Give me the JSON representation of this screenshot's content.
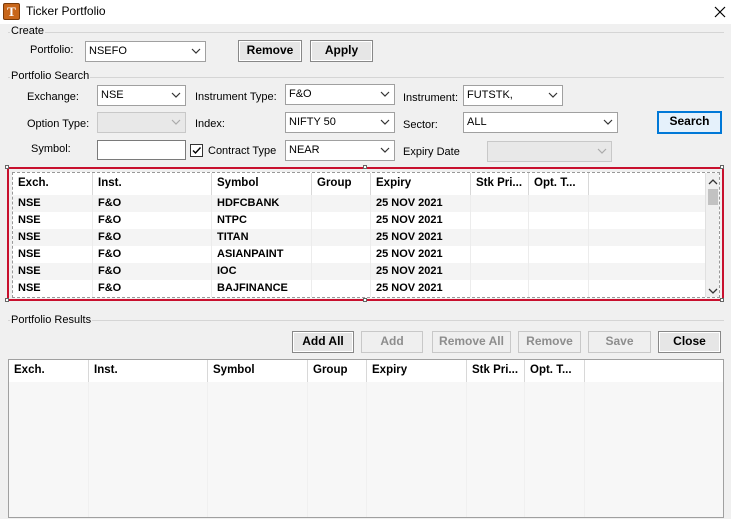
{
  "window": {
    "title": "Ticker Portfolio",
    "icon_letter": "T"
  },
  "create": {
    "legend": "Create",
    "portfolio_label": "Portfolio:",
    "portfolio_value": "NSEFO",
    "remove_label": "Remove",
    "apply_label": "Apply"
  },
  "search": {
    "legend": "Portfolio Search",
    "exchange_label": "Exchange:",
    "exchange_value": "NSE",
    "instrument_type_label": "Instrument Type:",
    "instrument_type_value": "F&O",
    "instrument_label": "Instrument:",
    "instrument_value": "FUTSTK,",
    "option_type_label": "Option Type:",
    "option_type_value": "",
    "index_label": "Index:",
    "index_value": "NIFTY 50",
    "sector_label": "Sector:",
    "sector_value": "ALL",
    "search_label": "Search",
    "symbol_label": "Symbol:",
    "symbol_value": "",
    "contract_type_label": "Contract Type",
    "contract_type_value": "NEAR",
    "expiry_label": "Expiry Date",
    "expiry_value": ""
  },
  "columns": [
    "Exch.",
    "Inst.",
    "Symbol",
    "Group",
    "Expiry",
    "Stk Pri...",
    "Opt. T..."
  ],
  "search_rows": [
    [
      "NSE",
      "F&O",
      "HDFCBANK",
      "",
      "25 NOV 2021",
      "",
      ""
    ],
    [
      "NSE",
      "F&O",
      "NTPC",
      "",
      "25 NOV 2021",
      "",
      ""
    ],
    [
      "NSE",
      "F&O",
      "TITAN",
      "",
      "25 NOV 2021",
      "",
      ""
    ],
    [
      "NSE",
      "F&O",
      "ASIANPAINT",
      "",
      "25 NOV 2021",
      "",
      ""
    ],
    [
      "NSE",
      "F&O",
      "IOC",
      "",
      "25 NOV 2021",
      "",
      ""
    ],
    [
      "NSE",
      "F&O",
      "BAJFINANCE",
      "",
      "25 NOV 2021",
      "",
      ""
    ]
  ],
  "results": {
    "legend": "Portfolio Results",
    "add_all_label": "Add All",
    "add_label": "Add",
    "remove_all_label": "Remove All",
    "remove_label": "Remove",
    "save_label": "Save",
    "close_label": "Close"
  },
  "icons": {
    "close": "close-icon",
    "dropdown": "chevron-down-icon",
    "check": "checkmark-icon",
    "scroll_up": "chevron-up-icon",
    "scroll_down": "chevron-down-icon"
  },
  "colors": {
    "selection_frame": "#c8102e",
    "default_button": "#0078d7",
    "app_icon": "#c8661a"
  }
}
